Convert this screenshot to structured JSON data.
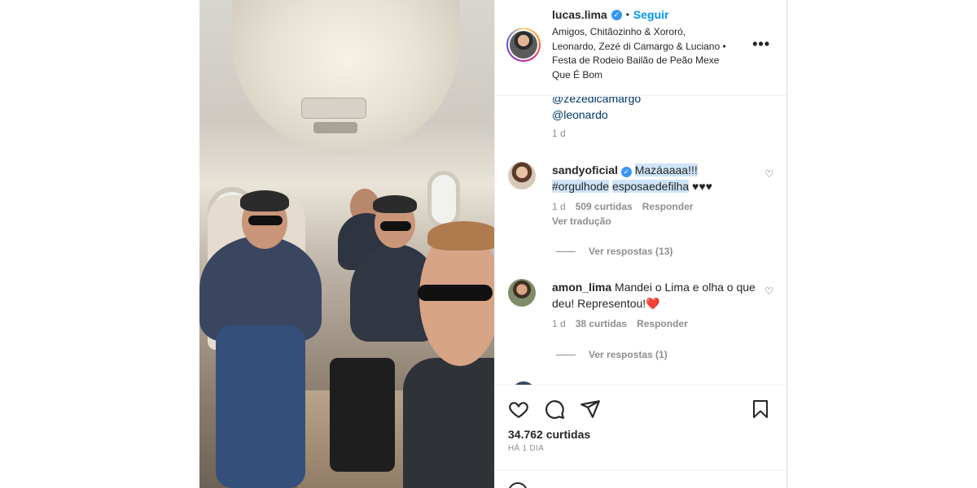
{
  "post": {
    "username": "lucas.lima",
    "separator": "•",
    "follow_label": "Seguir",
    "location": "Amigos, Chitãozinho & Xororó, Leonardo, Zezé di Camargo & Luciano • Festa de Rodeio Bailão de Peão Mexe Que É Bom",
    "more_label": "•••"
  },
  "caption_tail": {
    "mention1": "@zezedicamargo",
    "mention2": "@leonardo",
    "time": "1 d"
  },
  "comments": [
    {
      "username": "sandyoficial",
      "text_highlight_1": "Mazáaaaa!!!",
      "text_highlight_2": "#orgulhode",
      "text_highlight_3": "esposaedefilha",
      "text_tail": " ♥♥♥",
      "time": "1 d",
      "likes": "509 curtidas",
      "reply_label": "Responder",
      "translate_label": "Ver tradução",
      "view_replies": "Ver respostas (13)"
    },
    {
      "username": "amon_lima",
      "text": "Mandei o Lima e olha o que deu! Representou!",
      "emoji": "❤️",
      "time": "1 d",
      "likes": "38 curtidas",
      "reply_label": "Responder",
      "view_replies": "Ver respostas (1)"
    }
  ],
  "footer": {
    "likes_count": "34.762 curtidas",
    "posted_ago": "HÁ 1 DIA"
  },
  "icons": {
    "like": "heart-icon",
    "comment": "comment-icon",
    "share": "share-icon",
    "save": "bookmark-icon",
    "more": "more-options-icon",
    "verified": "verified-badge-icon"
  },
  "colors": {
    "link_blue": "#0095f6",
    "mention_blue": "#00376b",
    "verified_blue": "#3897f0",
    "muted_gray": "#8e8e8e",
    "highlight": "#cfe4fa"
  }
}
